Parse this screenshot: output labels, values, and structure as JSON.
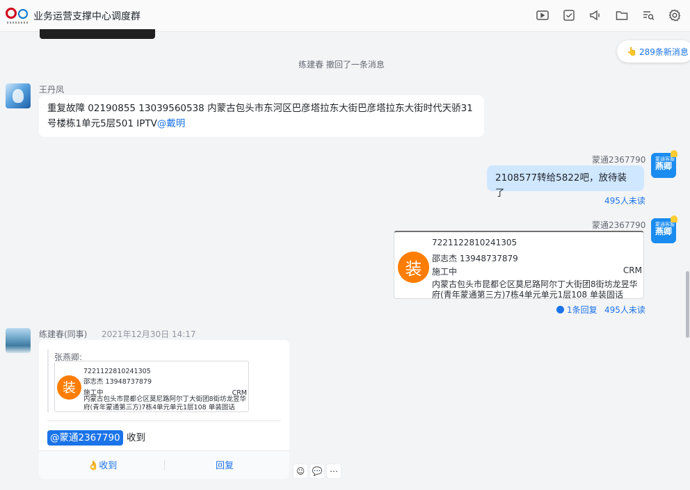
{
  "header": {
    "title": "业务运营支撑中心调度群",
    "icons": [
      "video-icon",
      "task-check-icon",
      "announcement-icon",
      "folder-icon",
      "search-history-icon",
      "settings-icon"
    ]
  },
  "new_messages": "289条新消息",
  "system_notice": "练建春 撤回了一条消息",
  "messages": [
    {
      "sender": "王丹凤",
      "text": "重复故障   02190855    13039560538   内蒙古包头市东河区巴彦塔拉东大街巴彦塔拉东大街时代天骄31号楼栋1单元5层501  IPTV",
      "mention": "@戴明"
    },
    {
      "sender": "蒙通2367790",
      "avatar_text": "燕卿",
      "text": "2108577转给5822吧，放待装了",
      "unread": "495人未读"
    },
    {
      "sender": "蒙通2367790",
      "avatar_text": "燕卿",
      "card": {
        "badge": "装",
        "order_no": "7221122810241305",
        "person": "邵志杰  13948737879",
        "status": "施工中",
        "system": "CRM",
        "address": "内蒙古包头市昆都仑区莫尼路阿尔丁大街团8街坊龙昱华府(青年蒙通第三方)7栋4单元单元1层108 单装固话"
      },
      "replies": "1条回复",
      "unread": "495人未读"
    },
    {
      "sender": "练建春(同事)",
      "time": "2021年12月30日 14:17",
      "quote_name": "张燕卿:",
      "quote_card": {
        "badge": "装",
        "order_no": "7221122810241305",
        "person": "邵志杰  13948737879",
        "status": "施工中",
        "system": "CRM",
        "address": "内蒙古包头市昆都仑区莫尼路阿尔丁大街团8街坊龙昱华府(青年蒙通第三方)7栋4单元单元1层108 单装固话"
      },
      "mention": "@蒙通2367790",
      "text": "收到",
      "action_ack": "收到",
      "action_reply": "回复"
    }
  ],
  "colors": {
    "accent": "#1a73e8",
    "self_bubble": "#cfe7ff",
    "install_badge": "#ff7d00"
  }
}
